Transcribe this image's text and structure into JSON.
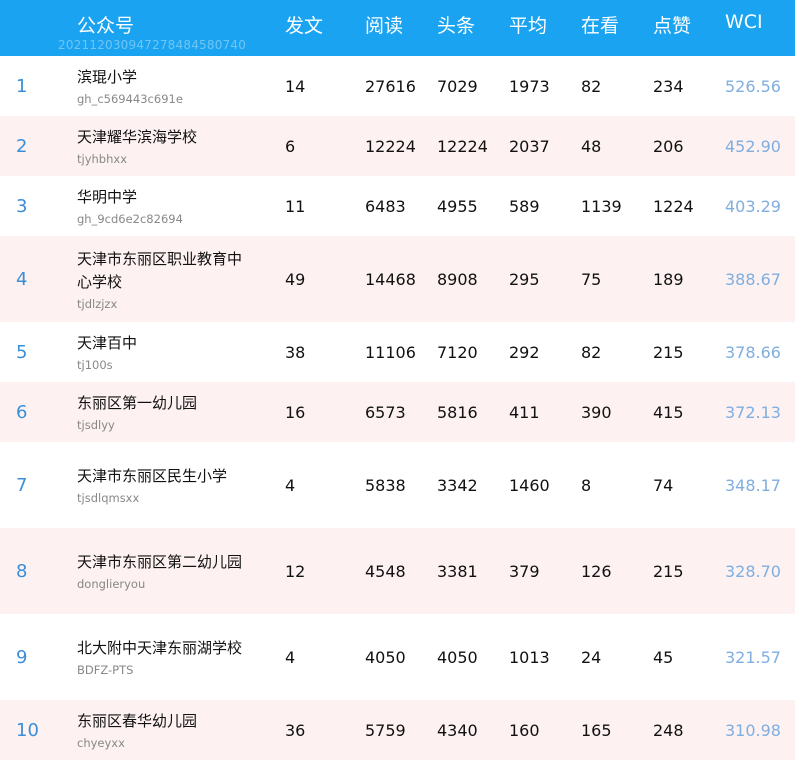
{
  "header": {
    "account": "公众号",
    "account_sub": "2021120309472784845807​40",
    "posts": "发文",
    "reads": "阅读",
    "headline": "头条",
    "average": "平均",
    "looking": "在看",
    "likes": "点赞",
    "wci": "WCI"
  },
  "rows": [
    {
      "rank": "1",
      "name": "滨琨小学",
      "wx": "gh_c569443c691e",
      "posts": "14",
      "reads": "27616",
      "headline": "7029",
      "average": "1973",
      "looking": "82",
      "likes": "234",
      "wci": "526.56"
    },
    {
      "rank": "2",
      "name": "天津耀华滨海学校",
      "wx": "tjyhbhxx",
      "posts": "6",
      "reads": "12224",
      "headline": "12224",
      "average": "2037",
      "looking": "48",
      "likes": "206",
      "wci": "452.90"
    },
    {
      "rank": "3",
      "name": "华明中学",
      "wx": "gh_9cd6e2c82694",
      "posts": "11",
      "reads": "6483",
      "headline": "4955",
      "average": "589",
      "looking": "1139",
      "likes": "1224",
      "wci": "403.29"
    },
    {
      "rank": "4",
      "name": "天津市东丽区职业教育中心学校",
      "wx": "tjdlzjzx",
      "posts": "49",
      "reads": "14468",
      "headline": "8908",
      "average": "295",
      "looking": "75",
      "likes": "189",
      "wci": "388.67"
    },
    {
      "rank": "5",
      "name": "天津百中",
      "wx": "tj100s",
      "posts": "38",
      "reads": "11106",
      "headline": "7120",
      "average": "292",
      "looking": "82",
      "likes": "215",
      "wci": "378.66"
    },
    {
      "rank": "6",
      "name": "东丽区第一幼儿园",
      "wx": "tjsdlyy",
      "posts": "16",
      "reads": "6573",
      "headline": "5816",
      "average": "411",
      "looking": "390",
      "likes": "415",
      "wci": "372.13"
    },
    {
      "rank": "7",
      "name": "天津市东丽区民生小学",
      "wx": "tjsdlqmsxx",
      "posts": "4",
      "reads": "5838",
      "headline": "3342",
      "average": "1460",
      "looking": "8",
      "likes": "74",
      "wci": "348.17"
    },
    {
      "rank": "8",
      "name": "天津市东丽区第二幼儿园",
      "wx": "donglieryou",
      "posts": "12",
      "reads": "4548",
      "headline": "3381",
      "average": "379",
      "looking": "126",
      "likes": "215",
      "wci": "328.70"
    },
    {
      "rank": "9",
      "name": "北大附中天津东丽湖学校",
      "wx": "BDFZ-PTS",
      "posts": "4",
      "reads": "4050",
      "headline": "4050",
      "average": "1013",
      "looking": "24",
      "likes": "45",
      "wci": "321.57"
    },
    {
      "rank": "10",
      "name": "东丽区春华幼儿园",
      "wx": "chyeyxx",
      "posts": "36",
      "reads": "5759",
      "headline": "4340",
      "average": "160",
      "looking": "165",
      "likes": "248",
      "wci": "310.98"
    }
  ]
}
